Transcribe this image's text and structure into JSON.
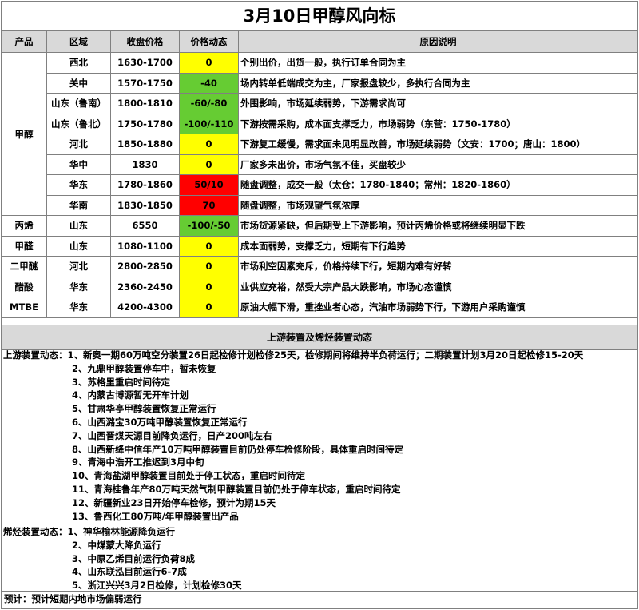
{
  "title": "3月10日甲醇风向标",
  "headers": [
    "产品",
    "区域",
    "收盘价格",
    "价格动态",
    "原因说明"
  ],
  "colors": {
    "up": "#ff0000",
    "flat": "#ffff00",
    "down": "#66cc33",
    "header": "#d9d9d9"
  },
  "rows": [
    {
      "product": "甲醇",
      "region": "西北",
      "price": "1630-1700",
      "change": "0",
      "trend": "flat",
      "reason": "个别出价，出货一般，执行订单合同为主"
    },
    {
      "product": "",
      "region": "关中",
      "price": "1570-1750",
      "change": "-40",
      "trend": "down",
      "reason": "场内转单低端成交为主，厂家报盘较少，多执行合同为主"
    },
    {
      "product": "",
      "region": "山东（鲁南）",
      "price": "1800-1810",
      "change": "-60/-80",
      "trend": "down",
      "reason": "外围影响，市场延续弱势，下游需求尚可"
    },
    {
      "product": "",
      "region": "山东（鲁北）",
      "price": "1750-1780",
      "change": "-100/-110",
      "trend": "down",
      "reason": "下游按需采购，成本面支撑乏力，市场弱势（东营：1750-1780）"
    },
    {
      "product": "",
      "region": "河北",
      "price": "1850-1880",
      "change": "0",
      "trend": "flat",
      "reason": "下游复工缓慢，需求面未见明显改善，市场延续弱势（文安：1700；唐山：1800）"
    },
    {
      "product": "",
      "region": "华中",
      "price": "1830",
      "change": "0",
      "trend": "flat",
      "reason": "厂家多未出价，市场气氛不佳，买盘较少"
    },
    {
      "product": "",
      "region": "华东",
      "price": "1780-1860",
      "change": "50/10",
      "trend": "up",
      "reason": "随盘调整，成交一般（太仓：1780-1840；常州：1820-1860）"
    },
    {
      "product": "",
      "region": "华南",
      "price": "1830-1850",
      "change": "70",
      "trend": "up",
      "reason": "随盘调整，市场观望气氛浓厚"
    },
    {
      "product": "丙烯",
      "region": "山东",
      "price": "6550",
      "change": "-100/-50",
      "trend": "down",
      "reason": "市场货源紧缺，但后期受上下游影响，预计丙烯价格或将继续明显下跌"
    },
    {
      "product": "甲醛",
      "region": "山东",
      "price": "1080-1100",
      "change": "0",
      "trend": "flat",
      "reason": "成本面弱势，支撑乏力，短期有下行趋势"
    },
    {
      "product": "二甲醚",
      "region": "河北",
      "price": "2800-2850",
      "change": "0",
      "trend": "flat",
      "reason": "市场利空因素充斥，价格持续下行，短期内难有好转"
    },
    {
      "product": "醋酸",
      "region": "华东",
      "price": "2360-2450",
      "change": "0",
      "trend": "flat",
      "reason": "业供应充裕，然受大宗产品大跌影响，市场心态谨慎"
    },
    {
      "product": "MTBE",
      "region": "华东",
      "price": "4200-4300",
      "change": "0",
      "trend": "flat",
      "reason": "原油大幅下滑，重挫业者心态，汽油市场弱势下行，下游用户采购谨慎"
    }
  ],
  "section_title": "上游装置及烯烃装置动态",
  "upstream": {
    "label": "上游装置动态：",
    "items": [
      "1、新奥一期60万吨空分装置26日起检修计划检修25天，检修期间将维持半负荷运行；二期装置计划3月20日起检修15-20天",
      "2、九鼎甲醇装置停车中，暂未恢复",
      "3、苏格里重启时间待定",
      "4、内蒙古博源暂无开车计划",
      "5、甘肃华亭甲醇装置恢复正常运行",
      "6、山西潞宝30万吨甲醇装置恢复正常运行",
      "7、山西晋煤天源目前降负运行，日产200吨左右",
      "8、山西新绛中信年产10万吨甲醇装置目前仍处停车检修阶段，具体重启时间待定",
      "9、青海中浩开工推迟到3月中旬",
      "10、青海盐湖甲醇装置目前处于停工状态，重启时间待定",
      "11、青海桂鲁年产80万吨天然气制甲醇装置目前仍处于停车状态，重启时间待定",
      "12、新疆新业23日开始停车检修，预计为期15天",
      "13、鲁西化工80万吨/年甲醇装置出产品"
    ]
  },
  "olefin": {
    "label": "烯烃装置动态：",
    "items": [
      "1、神华榆林能源降负运行",
      "2、中煤蒙大降负运行",
      "3、中原乙烯目前运行负荷8成",
      "4、山东联泓目前运行6-7成",
      "5、浙江兴兴3月2日检修，计划检修30天"
    ]
  },
  "forecast": "预计：预计短期内地市场偏弱运行"
}
